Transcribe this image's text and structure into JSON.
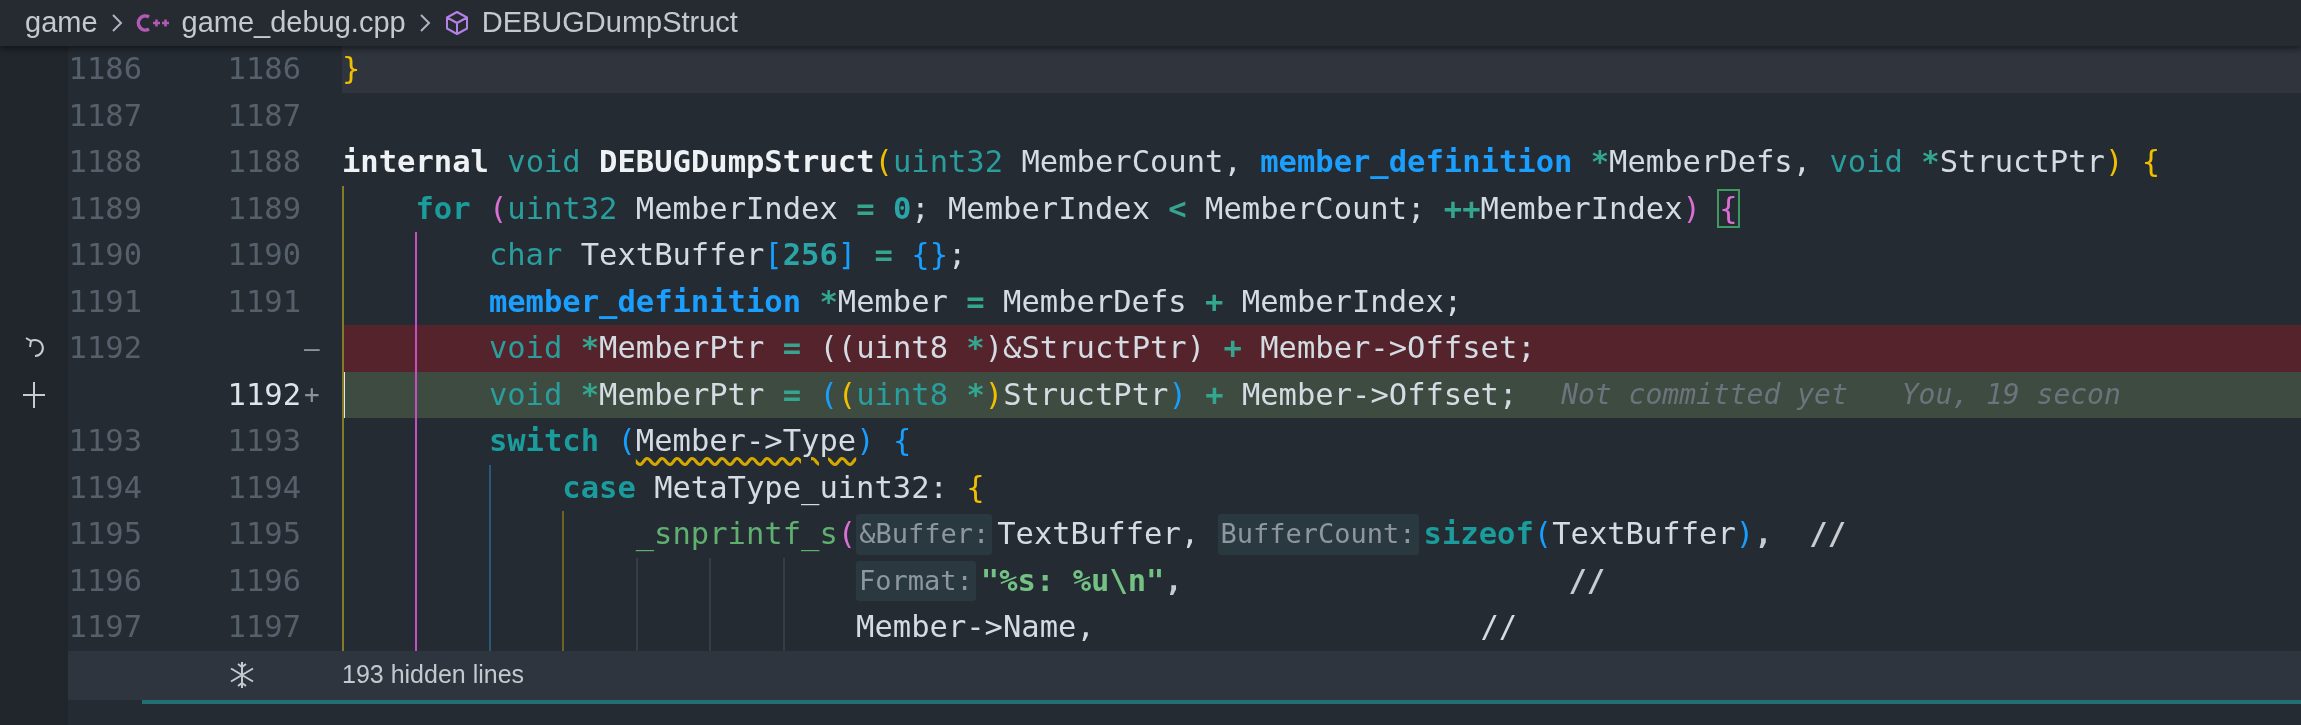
{
  "breadcrumb": [
    {
      "label": "game",
      "kind": "folder"
    },
    {
      "label": "game_debug.cpp",
      "kind": "cpp-file"
    },
    {
      "label": "DEBUGDumpStruct",
      "kind": "symbol"
    }
  ],
  "lines": [
    {
      "old": "1186",
      "new": "1186",
      "kind": "highlighted",
      "tokens": [
        {
          "t": "}",
          "kind": "b1"
        }
      ]
    },
    {
      "old": "1187",
      "new": "1187",
      "kind": "context"
    },
    {
      "old": "1188",
      "new": "1188",
      "kind": "context",
      "tokens": [
        {
          "t": "internal ",
          "kind": "kw"
        },
        {
          "t": "void ",
          "kind": "type"
        },
        {
          "t": "DEBUGDumpStruct",
          "kind": "fn"
        },
        {
          "t": "(",
          "kind": "b1"
        },
        {
          "t": "uint32",
          "kind": "type"
        },
        {
          "t": " MemberCount, ",
          "kind": "id"
        },
        {
          "t": "member_definition ",
          "kind": "struct"
        },
        {
          "t": "*",
          "kind": "op"
        },
        {
          "t": "MemberDefs, ",
          "kind": "id"
        },
        {
          "t": "void ",
          "kind": "type"
        },
        {
          "t": "*",
          "kind": "op"
        },
        {
          "t": "StructPtr",
          "kind": "id"
        },
        {
          "t": ") ",
          "kind": "b1"
        },
        {
          "t": "{",
          "kind": "b1"
        }
      ]
    },
    {
      "old": "1189",
      "new": "1189",
      "kind": "context",
      "tokens": [
        {
          "t": "    for ",
          "kind": "ctl"
        },
        {
          "t": "(",
          "kind": "b2"
        },
        {
          "t": "uint32",
          "kind": "type"
        },
        {
          "t": " MemberIndex ",
          "kind": "id"
        },
        {
          "t": "= ",
          "kind": "op"
        },
        {
          "t": "0",
          "kind": "num"
        },
        {
          "t": "; MemberIndex ",
          "kind": "id"
        },
        {
          "t": "<",
          "kind": "op"
        },
        {
          "t": " MemberCount; ",
          "kind": "id"
        },
        {
          "t": "++",
          "kind": "op"
        },
        {
          "t": "MemberIndex",
          "kind": "id"
        },
        {
          "t": ") ",
          "kind": "b2"
        },
        {
          "t": "{",
          "kind": "b2m"
        }
      ]
    },
    {
      "old": "1190",
      "new": "1190",
      "kind": "context",
      "tokens": [
        {
          "t": "        char",
          "kind": "type"
        },
        {
          "t": " TextBuffer",
          "kind": "id"
        },
        {
          "t": "[",
          "kind": "b3"
        },
        {
          "t": "256",
          "kind": "num"
        },
        {
          "t": "] ",
          "kind": "b3"
        },
        {
          "t": "= ",
          "kind": "op"
        },
        {
          "t": "{}",
          "kind": "b3"
        },
        {
          "t": ";",
          "kind": "id"
        }
      ]
    },
    {
      "old": "1191",
      "new": "1191",
      "kind": "context",
      "tokens": [
        {
          "t": "        member_definition ",
          "kind": "struct"
        },
        {
          "t": "*",
          "kind": "op"
        },
        {
          "t": "Member ",
          "kind": "id"
        },
        {
          "t": "=",
          "kind": "op"
        },
        {
          "t": " MemberDefs ",
          "kind": "id"
        },
        {
          "t": "+",
          "kind": "op"
        },
        {
          "t": " MemberIndex;",
          "kind": "id"
        }
      ]
    },
    {
      "old": "1192",
      "marker": "—",
      "kind": "deleted",
      "tokens": [
        {
          "t": "        void ",
          "kind": "type"
        },
        {
          "t": "*",
          "kind": "op"
        },
        {
          "t": "MemberPtr ",
          "kind": "id"
        },
        {
          "t": "=",
          "kind": "op"
        },
        {
          "t": " ((uint8 ",
          "kind": "id"
        },
        {
          "t": "*",
          "kind": "op"
        },
        {
          "t": ")&StructPtr) ",
          "kind": "id"
        },
        {
          "t": "+",
          "kind": "op"
        },
        {
          "t": " Member->Offset;",
          "kind": "id"
        }
      ]
    },
    {
      "new": "1192",
      "marker": "+",
      "kind": "added",
      "tokens": [
        {
          "t": "        void ",
          "kind": "type"
        },
        {
          "t": "*",
          "kind": "op"
        },
        {
          "t": "MemberPtr ",
          "kind": "id"
        },
        {
          "t": "= ",
          "kind": "op"
        },
        {
          "t": "(",
          "kind": "b3"
        },
        {
          "t": "(",
          "kind": "b1"
        },
        {
          "t": "uint8 ",
          "kind": "type"
        },
        {
          "t": "*",
          "kind": "op"
        },
        {
          "t": ")",
          "kind": "b1"
        },
        {
          "t": "StructPtr",
          "kind": "id"
        },
        {
          "t": ") ",
          "kind": "b3"
        },
        {
          "t": "+",
          "kind": "op"
        },
        {
          "t": " Member->Offset;",
          "kind": "id"
        },
        {
          "t": "Not committed yet",
          "kind": "blame"
        },
        {
          "t": "You, 19 secon",
          "kind": "blame"
        }
      ]
    },
    {
      "old": "1193",
      "new": "1193",
      "kind": "context",
      "tokens": [
        {
          "t": "        switch ",
          "kind": "ctl"
        },
        {
          "t": "(",
          "kind": "b3"
        },
        {
          "t": "Member->Type",
          "kind": "warn"
        },
        {
          "t": ") ",
          "kind": "b3"
        },
        {
          "t": "{",
          "kind": "b3"
        }
      ]
    },
    {
      "old": "1194",
      "new": "1194",
      "kind": "context",
      "tokens": [
        {
          "t": "            case",
          "kind": "ctl"
        },
        {
          "t": " MetaType_uint32: ",
          "kind": "id"
        },
        {
          "t": "{",
          "kind": "b1"
        }
      ]
    },
    {
      "old": "1195",
      "new": "1195",
      "kind": "context",
      "tokens": [
        {
          "t": "                _snprintf_s",
          "kind": "call"
        },
        {
          "t": "(",
          "kind": "b2"
        },
        {
          "t": "&Buffer:",
          "kind": "hint"
        },
        {
          "t": "TextBuffer, ",
          "kind": "id"
        },
        {
          "t": "BufferCount:",
          "kind": "hint"
        },
        {
          "t": "sizeof",
          "kind": "ctl"
        },
        {
          "t": "(",
          "kind": "b3"
        },
        {
          "t": "TextBuffer",
          "kind": "id"
        },
        {
          "t": ")",
          "kind": "b3"
        },
        {
          "t": ",  //",
          "kind": "comment"
        }
      ]
    },
    {
      "old": "1196",
      "new": "1196",
      "kind": "context",
      "tokens": [
        {
          "t": "                            Format:",
          "kind": "hint"
        },
        {
          "t": "\"%s: %u\\n\"",
          "kind": "str"
        },
        {
          "t": ",                     //",
          "kind": "comment"
        }
      ]
    },
    {
      "old": "1197",
      "new": "1197",
      "kind": "context",
      "tokens": [
        {
          "t": "                            Member->Name,                     //",
          "kind": "id"
        }
      ]
    }
  ],
  "fold_bar": {
    "label": "193 hidden lines"
  }
}
